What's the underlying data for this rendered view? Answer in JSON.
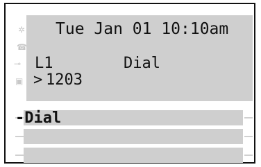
{
  "status": {
    "datetime": "Tue Jan 01 10:10am"
  },
  "line": {
    "label": "L1",
    "state": "Dial",
    "entry_prefix": ">",
    "entry_number": "1203"
  },
  "softkeys": [
    {
      "label": "-Dial"
    },
    {
      "label": ""
    },
    {
      "label": ""
    }
  ],
  "icons": {
    "left_column": [
      "settings-icon",
      "phone-icon",
      "key-icon",
      "message-icon"
    ]
  },
  "colors": {
    "screen_background": "#cfcfcf",
    "text": "#111111",
    "frame": "#111111",
    "icon_dim": "#c8c8c8"
  }
}
